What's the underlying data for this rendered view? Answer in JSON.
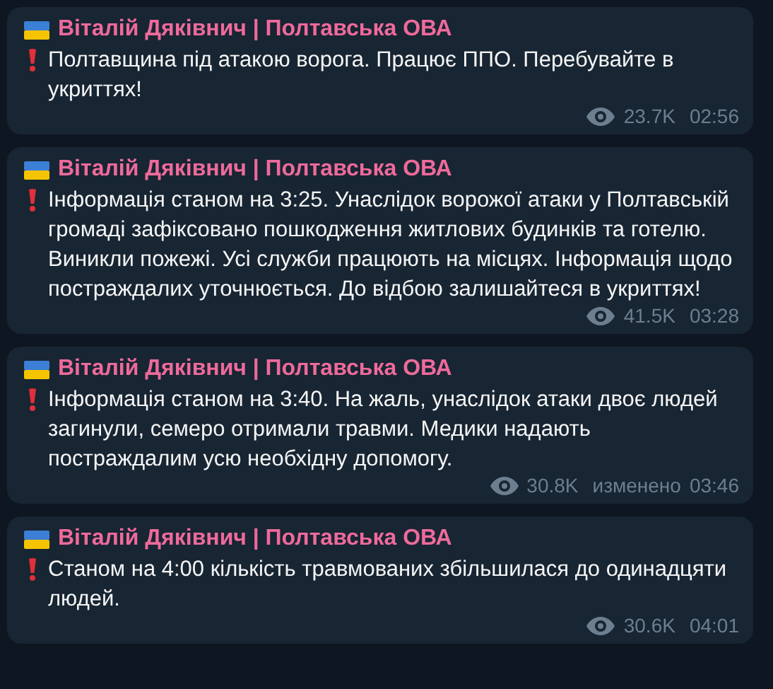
{
  "messages": [
    {
      "author": "Віталій Дяківнич | Полтавська ОВА",
      "text": "Полтавщина під атакою ворога. Працює ППО. Перебувайте в укриттях!",
      "views": "23.7K",
      "time": "02:56"
    },
    {
      "author": "Віталій Дяківнич | Полтавська ОВА",
      "text": "Інформація станом на 3:25. Унаслідок ворожої атаки у Полтавській громаді зафіксовано пошкодження житлових будинків та готелю. Виникли пожежі. Усі служби працюють на місцях. Інформація щодо постраждалих уточнюється. До відбою залишайтеся в укриттях!",
      "views": "41.5K",
      "time": "03:28"
    },
    {
      "author": "Віталій Дяківнич | Полтавська ОВА",
      "text": "Інформація станом на 3:40. На жаль, унаслідок атаки двоє людей загинули, семеро отримали травми. Медики надають постраждалим усю необхідну допомогу.",
      "views": "30.8K",
      "edited_label": "изменено",
      "time": "03:46"
    },
    {
      "author": "Віталій Дяківнич | Полтавська ОВА",
      "text": "Станом на 4:00 кількість травмованих збільшилася до одинадцяти людей.",
      "views": "30.6K",
      "time": "04:01"
    }
  ]
}
